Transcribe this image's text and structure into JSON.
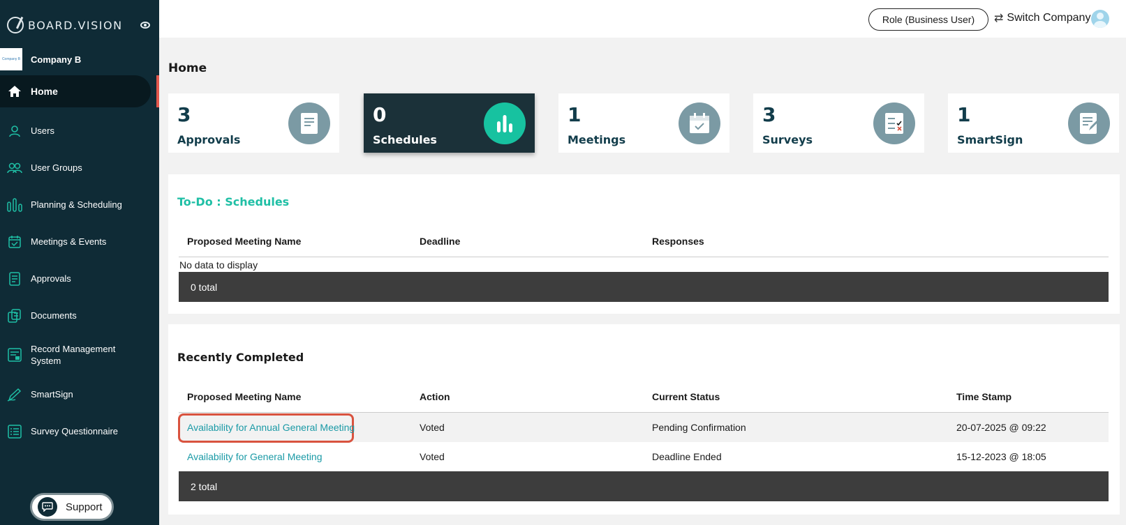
{
  "sidebar": {
    "brand": "BOARD.VISION",
    "company": {
      "name": "Company B",
      "logo_text": "Company B"
    },
    "items": [
      {
        "label": "Home",
        "icon": "home-icon"
      },
      {
        "label": "Users",
        "icon": "user-icon"
      },
      {
        "label": "User Groups",
        "icon": "user-group-icon"
      },
      {
        "label": "Planning & Scheduling",
        "icon": "bars-icon"
      },
      {
        "label": "Meetings & Events",
        "icon": "calendar-check-icon"
      },
      {
        "label": "Approvals",
        "icon": "document-icon"
      },
      {
        "label": "Documents",
        "icon": "documents-icon"
      },
      {
        "label": "Record Management System",
        "icon": "record-icon"
      },
      {
        "label": "SmartSign",
        "icon": "pen-icon"
      },
      {
        "label": "Survey Questionnaire",
        "icon": "survey-icon"
      }
    ],
    "support_label": "Support"
  },
  "header": {
    "role_label": "Role (Business User)",
    "switch_label": "Switch Company"
  },
  "page_title": "Home",
  "cards": [
    {
      "count": "3",
      "label": "Approvals"
    },
    {
      "count": "0",
      "label": "Schedules"
    },
    {
      "count": "1",
      "label": "Meetings"
    },
    {
      "count": "3",
      "label": "Surveys"
    },
    {
      "count": "1",
      "label": "SmartSign"
    }
  ],
  "todo": {
    "title": "To-Do : Schedules",
    "columns": [
      "Proposed Meeting Name",
      "Deadline",
      "Responses"
    ],
    "empty_text": "No data to display",
    "total": "0 total"
  },
  "completed": {
    "title": "Recently Completed",
    "columns": [
      "Proposed Meeting Name",
      "Action",
      "Current Status",
      "Time Stamp"
    ],
    "rows": [
      {
        "name": "Availability for Annual General Meeting",
        "action": "Voted",
        "status": "Pending Confirmation",
        "time": "20-07-2025 @ 09:22"
      },
      {
        "name": "Availability for General Meeting",
        "action": "Voted",
        "status": "Deadline Ended",
        "time": "15-12-2023 @ 18:05"
      }
    ],
    "total": "2 total"
  },
  "colors": {
    "sidebar_bg": "#0f2b36",
    "accent": "#1fbfa5",
    "highlight": "#d9533f"
  }
}
